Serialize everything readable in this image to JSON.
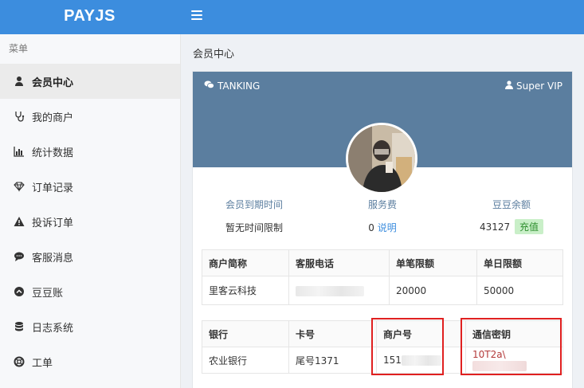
{
  "app": {
    "logo": "PAYJS"
  },
  "sidebar": {
    "header": "菜单",
    "items": [
      {
        "label": "会员中心",
        "icon": "user-icon",
        "active": true
      },
      {
        "label": "我的商户",
        "icon": "stethoscope-icon"
      },
      {
        "label": "统计数据",
        "icon": "bar-chart-icon"
      },
      {
        "label": "订单记录",
        "icon": "diamond-icon"
      },
      {
        "label": "投诉订单",
        "icon": "warning-icon"
      },
      {
        "label": "客服消息",
        "icon": "chat-icon"
      },
      {
        "label": "豆豆账",
        "icon": "circle-up-icon"
      },
      {
        "label": "日志系统",
        "icon": "database-icon"
      },
      {
        "label": "工单",
        "icon": "lifebuoy-icon"
      }
    ]
  },
  "main": {
    "title": "会员中心",
    "profile": {
      "username": "TANKING",
      "level": "Super VIP"
    },
    "stats": {
      "expire_label": "会员到期时间",
      "expire_value": "暂无时间限制",
      "fee_label": "服务费",
      "fee_value": "0",
      "fee_link": "说明",
      "balance_label": "豆豆余额",
      "balance_value": "43127",
      "recharge": "充值"
    },
    "merchant_table": {
      "headers": [
        "商户简称",
        "客服电话",
        "单笔限额",
        "单日限额"
      ],
      "row": [
        "里客云科技",
        "",
        "20000",
        "50000"
      ]
    },
    "bank_table": {
      "headers": [
        "银行",
        "卡号",
        "商户号",
        "通信密钥"
      ],
      "row": [
        "农业银行",
        "尾号1371",
        "151",
        "10T2a\\"
      ]
    }
  },
  "colors": {
    "topbar": "#3c8dde",
    "banner": "#5b7e9f",
    "highlight": "#e02020"
  }
}
